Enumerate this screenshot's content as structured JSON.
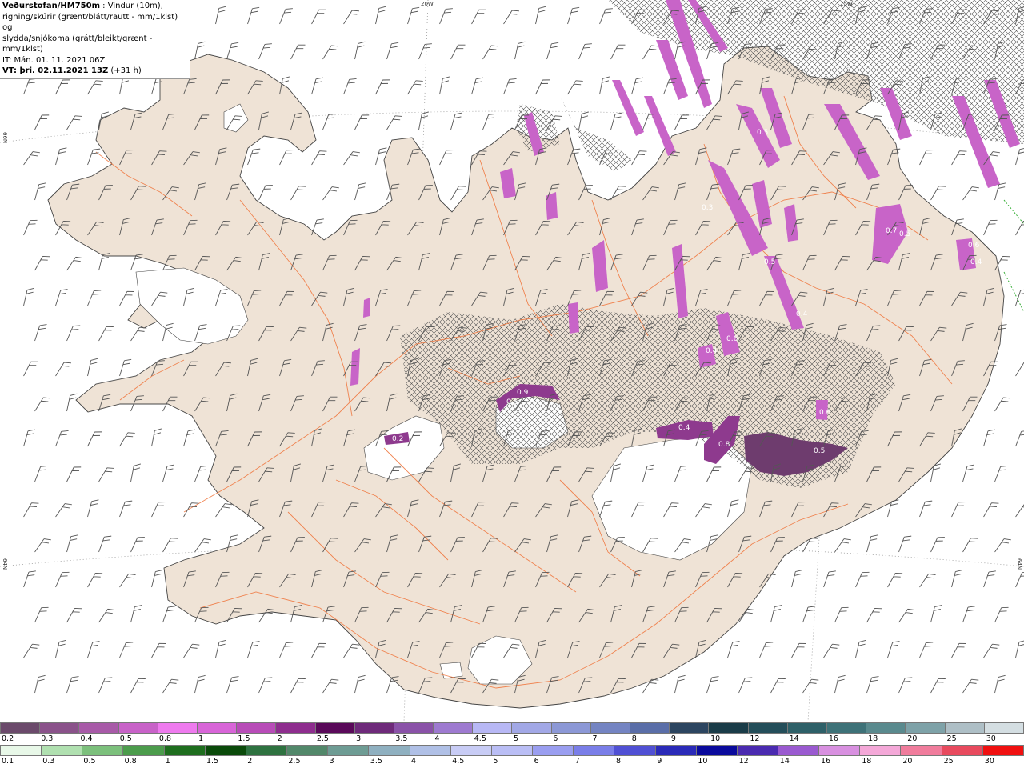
{
  "header": {
    "product": "Veðurstofan/HM750m",
    "description_line1": " : Vindur (10m),",
    "description_line2": "rigning/skúrir (grænt/blátt/rautt - mm/1klst) og",
    "description_line3": "slydda/snjókoma (grátt/bleikt/grænt - mm/1klst)",
    "init_time": "IT: Mán. 01. 11. 2021 06Z",
    "valid_time": "VT: þri. 02.11.2021 13Z",
    "lead_time": " (+31 h)"
  },
  "grid_labels": {
    "lon_20w": "20W",
    "lon_15w": "15W",
    "lat_66n_left": "66N",
    "lat_64n_left": "64N",
    "lat_64n_right": "64N"
  },
  "precip_labels": [
    "0.5",
    "0.4",
    "0.6",
    "0.2",
    "0.9",
    "0.5",
    "0.4",
    "0.6",
    "0.5",
    "0.4",
    "0.5",
    "0.7",
    "0.4",
    "0.6",
    "0.5",
    "0.8",
    "0.3"
  ],
  "legend": {
    "snow_scale": {
      "labels": [
        "0.2",
        "0.3",
        "0.4",
        "0.5",
        "0.8",
        "1",
        "1.5",
        "2",
        "2.5",
        "3",
        "3.5",
        "4",
        "4.5",
        "5",
        "6",
        "7",
        "8",
        "9",
        "10",
        "12",
        "14",
        "16",
        "18",
        "20",
        "25",
        "30"
      ],
      "colors": [
        "#6b4a6b",
        "#8a528a",
        "#a85aa8",
        "#c862c8",
        "#ee7aee",
        "#d865d8",
        "#b84cb8",
        "#8e2d8e",
        "#5a0a5a",
        "#6e2a7a",
        "#8a52a8",
        "#9e7ad0",
        "#b8b8f5",
        "#a2a8e6",
        "#8c98d6",
        "#7484c2",
        "#5a6ea8",
        "#2c4560",
        "#1a3c48",
        "#244e5a",
        "#2e6068",
        "#3e7278",
        "#5a8a8e",
        "#7ea2a8",
        "#aebfc6",
        "#d4dee2"
      ]
    },
    "rain_scale": {
      "labels": [
        "0.1",
        "0.3",
        "0.5",
        "0.8",
        "1",
        "1.5",
        "2",
        "2.5",
        "3",
        "3.5",
        "4",
        "4.5",
        "5",
        "6",
        "7",
        "8",
        "9",
        "10",
        "12",
        "14",
        "16",
        "18",
        "20",
        "25",
        "30"
      ],
      "colors": [
        "#e8f8e8",
        "#b0e0b0",
        "#7cc07c",
        "#4c9c4c",
        "#1e6e1e",
        "#0a4a0a",
        "#2e7240",
        "#52886a",
        "#6e9c94",
        "#8fb0c0",
        "#b0c0e6",
        "#c8ccf5",
        "#babef5",
        "#9a9ef0",
        "#7a7ee8",
        "#5050d4",
        "#2a2ab8",
        "#0a0a9c",
        "#4a2ab0",
        "#9a5ad0",
        "#d890e0",
        "#f4a8d8",
        "#f07c9c",
        "#e84a5e",
        "#f01010"
      ]
    }
  },
  "colors": {
    "land": "#efe3d6",
    "roads": "#f07840",
    "hatch": "#555555",
    "snow_precip": "#c864c8",
    "heavy_snow": "#6e3c6e",
    "wind_barbs": "#555555"
  }
}
